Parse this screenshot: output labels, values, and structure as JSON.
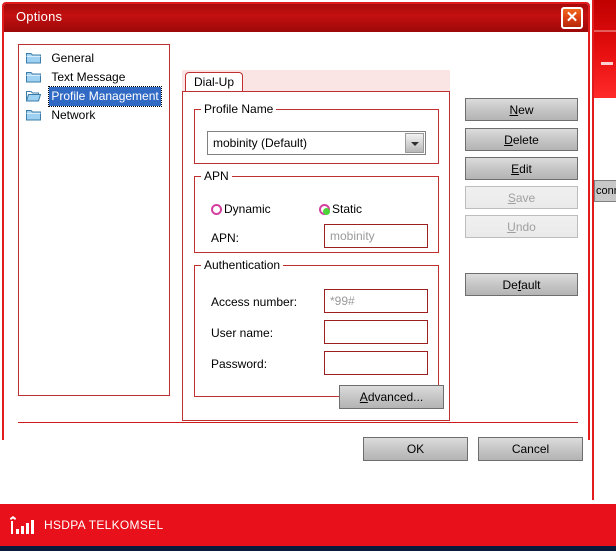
{
  "window": {
    "title": "Options",
    "close_label": "✕",
    "close_icon": "close-icon"
  },
  "sidebar": {
    "items": [
      {
        "label": "General",
        "icon": "folder-closed-icon",
        "selected": false
      },
      {
        "label": "Text Message",
        "icon": "folder-closed-icon",
        "selected": false
      },
      {
        "label": "Profile Management",
        "icon": "folder-open-icon",
        "selected": true
      },
      {
        "label": "Network",
        "icon": "folder-closed-icon",
        "selected": false
      }
    ]
  },
  "tabs": [
    {
      "label": "Dial-Up",
      "active": true
    }
  ],
  "profile_group": {
    "title": "Profile Name",
    "combo_value": "mobinity (Default)",
    "combo_icon": "chevron-down-icon"
  },
  "apn_group": {
    "title": "APN",
    "radio_dynamic": {
      "label": "Dynamic",
      "checked": false
    },
    "radio_static": {
      "label": "Static",
      "checked": true
    },
    "apn_label": "APN:",
    "apn_value": "mobinity"
  },
  "auth_group": {
    "title": "Authentication",
    "access_label": "Access number:",
    "access_value": "*99#",
    "user_label": "User name:",
    "user_value": "",
    "password_label": "Password:",
    "password_value": ""
  },
  "side_buttons": {
    "new": {
      "pre": "",
      "mn": "N",
      "post": "ew",
      "enabled": true
    },
    "delete": {
      "pre": "",
      "mn": "D",
      "post": "elete",
      "enabled": true
    },
    "edit": {
      "pre": "",
      "mn": "E",
      "post": "dit",
      "enabled": true
    },
    "save": {
      "pre": "",
      "mn": "S",
      "post": "ave",
      "enabled": false
    },
    "undo": {
      "pre": "",
      "mn": "U",
      "post": "ndo",
      "enabled": false
    },
    "default": {
      "pre": "De",
      "mn": "f",
      "post": "ault",
      "enabled": true
    }
  },
  "advanced_button": {
    "pre": "",
    "mn": "A",
    "post": "dvanced..."
  },
  "footer": {
    "ok_label": "OK",
    "cancel_label": "Cancel"
  },
  "background_window": {
    "button_label": "conne"
  },
  "statusbar": {
    "signal_icon": "signal-strength-icon",
    "text": "HSDPA  TELKOMSEL"
  },
  "colors": {
    "brand_red": "#e8111b",
    "titlebar_red": "#c41010",
    "dialog_border": "#e01b1b",
    "selection_blue": "#316ac5",
    "radio_magenta": "#d43fa0",
    "radio_green": "#4cd43a",
    "field_border": "#9c2020"
  }
}
